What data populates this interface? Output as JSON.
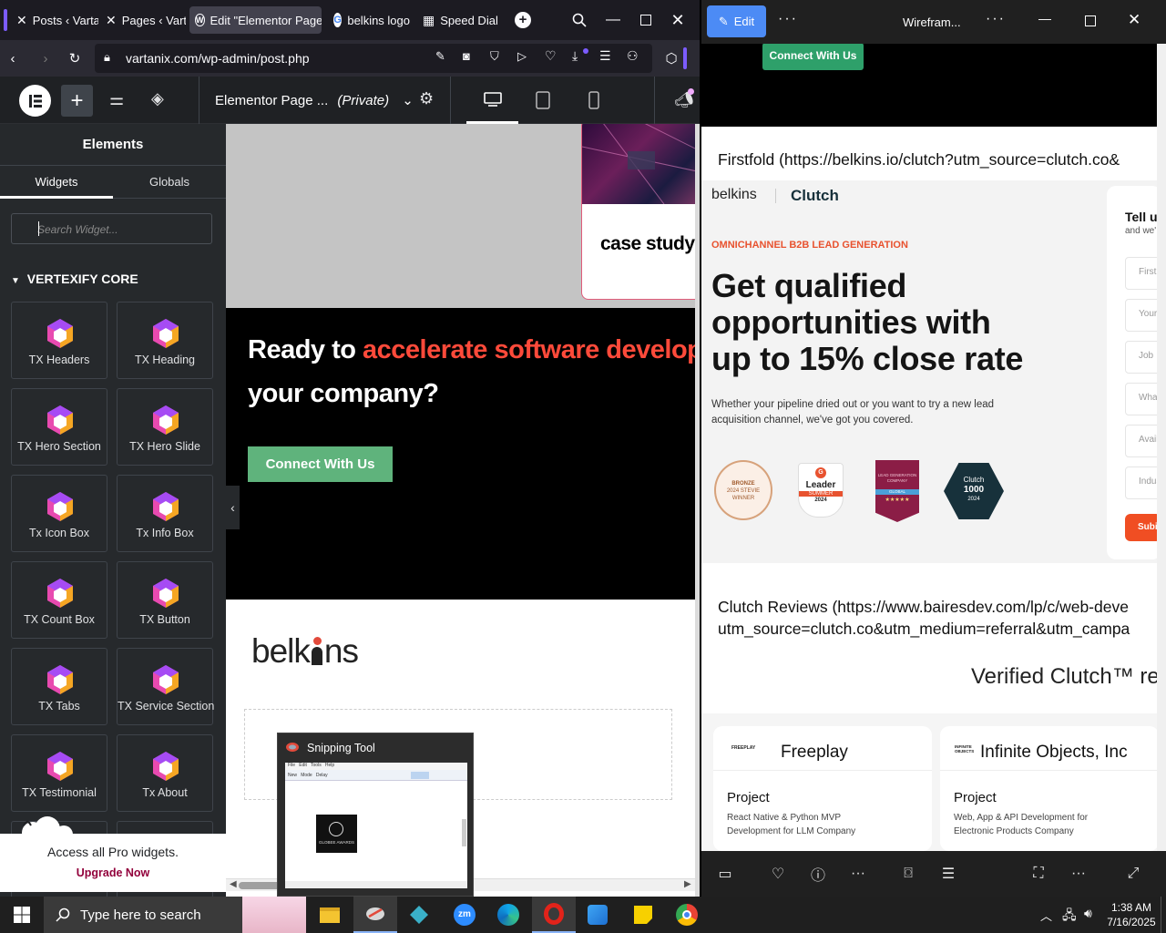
{
  "browser": {
    "tabs": [
      {
        "label": "Posts ‹ Vartar"
      },
      {
        "label": "Pages ‹ Varta"
      },
      {
        "label": "Edit \"Elementor Page"
      },
      {
        "label": "belkins logo"
      },
      {
        "label": "Speed Dial"
      }
    ],
    "url": "vartanix.com/wp-admin/post.php"
  },
  "elementor": {
    "page_title": "Elementor Page ...",
    "page_status": "(Private)",
    "panel_title": "Elements",
    "tab_widgets": "Widgets",
    "tab_globals": "Globals",
    "search_placeholder": "Search Widget...",
    "category": "VERTEXIFY CORE",
    "widgets": [
      "TX Headers",
      "TX Heading",
      "TX Hero Section",
      "TX Hero Slide",
      "Tx Icon Box",
      "Tx Info Box",
      "TX Count Box",
      "TX Button",
      "TX Tabs",
      "TX Service Section",
      "TX Testimonial",
      "Tx About"
    ],
    "promo_text": "Access all Pro widgets.",
    "promo_link": "Upgrade Now"
  },
  "canvas": {
    "case_study": "case study",
    "cta_heading_1": "Ready to ",
    "cta_heading_accent": "accelerate software developr",
    "cta_heading_2": "your company?",
    "cta_button": "Connect With Us",
    "logo_text_1": "belk",
    "logo_text_2": "ns"
  },
  "snipping_tool": {
    "title": "Snipping Tool",
    "menu": [
      "File",
      "Edit",
      "Tools",
      "Help"
    ],
    "toolbar": [
      "New",
      "Mode",
      "Delay"
    ],
    "award_text": "GLOBEE AWARDS"
  },
  "right_window": {
    "edit_button": "Edit",
    "title": "Wirefram...",
    "top_button": "Connect With Us",
    "firstfold_caption": "Firstfold (https://belkins.io/clutch?utm_source=clutch.co&",
    "brand_belkins": "belkins",
    "brand_clutch": "Clutch",
    "eyebrow": "OMNICHANNEL B2B LEAD GENERATION",
    "hero_heading": [
      "Get qualified",
      "opportunities with",
      "up to 15% close rate"
    ],
    "hero_sub": [
      "Whether your pipeline dried out or you want to try a new lead",
      "acquisition channel, we've got you covered."
    ],
    "badges": {
      "stevie": [
        "BRONZE",
        "2024 STEVIE",
        "WINNER"
      ],
      "g2": [
        "Leader",
        "SUMMER",
        "2024"
      ],
      "lead": [
        "LEAD GENERATION",
        "COMPANY",
        "GLOBAL"
      ],
      "clutch": [
        "Clutch",
        "1000",
        "2024"
      ]
    },
    "form_title": "Tell u",
    "form_sub": "and we'",
    "form_fields": [
      "First",
      "Your",
      "Job",
      "What",
      "Availa",
      "Indus"
    ],
    "form_submit": "Subi",
    "clutch_reviews_caption": [
      "Clutch Reviews (https://www.bairesdev.com/lp/c/web-deve",
      "utm_source=clutch.co&utm_medium=referral&utm_campa"
    ],
    "verified": "Verified Clutch™ re",
    "reviews": [
      {
        "logo": "FREEPLAY",
        "name": "Freeplay",
        "project_label": "Project",
        "project_desc": [
          "React Native & Python MVP",
          "Development for LLM Company"
        ]
      },
      {
        "logo": "INFINITE OBJECTS",
        "name": "Infinite Objects, Inc",
        "project_label": "Project",
        "project_desc": [
          "Web, App & API Development for",
          "Electronic Products Company"
        ]
      }
    ]
  },
  "taskbar": {
    "search_placeholder": "Type here to search",
    "time": "1:38 AM",
    "date": "7/16/2025"
  }
}
